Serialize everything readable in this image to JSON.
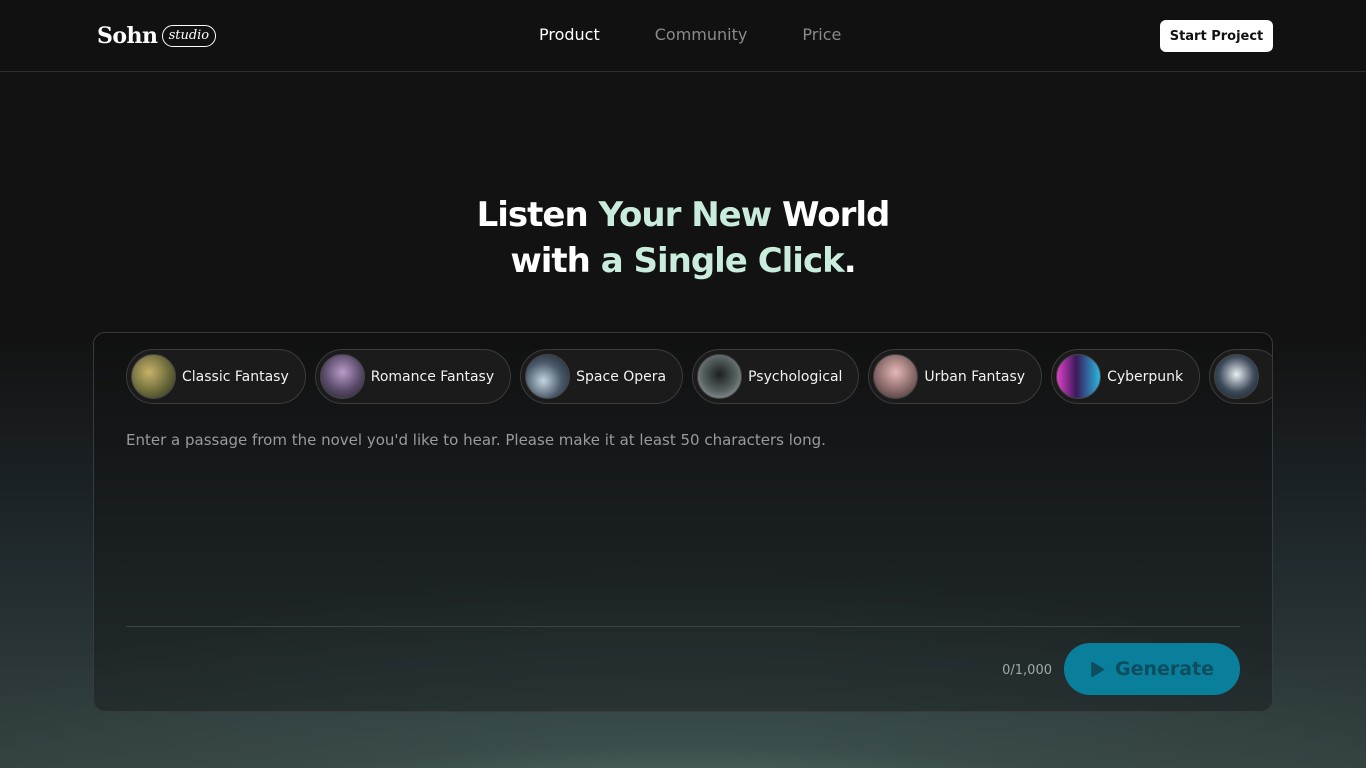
{
  "header": {
    "logo_word": "Sohn",
    "logo_badge": "studio",
    "nav": [
      {
        "label": "Product"
      },
      {
        "label": "Community"
      },
      {
        "label": "Price"
      }
    ],
    "cta_label": "Start Project"
  },
  "hero": {
    "line1_a": "Listen ",
    "line1_b": "Your New",
    "line1_c": " World",
    "line2_a": "with ",
    "line2_b": "a Single Click",
    "line2_c": "."
  },
  "genres": [
    {
      "label": "Classic Fantasy",
      "thumb": "#6b6a3a"
    },
    {
      "label": "Romance Fantasy",
      "thumb": "#5a4a6a"
    },
    {
      "label": "Space Opera",
      "thumb": "#4a5a6a"
    },
    {
      "label": "Psychological",
      "thumb": "#5a6464"
    },
    {
      "label": "Urban Fantasy",
      "thumb": "#8a6a6a"
    },
    {
      "label": "Cyberpunk",
      "thumb": "#6a3a7a"
    },
    {
      "label": "",
      "thumb": "#3c4a5a"
    }
  ],
  "editor": {
    "placeholder": "Enter a passage from the novel you'd like to hear. Please make it at least 50 characters long.",
    "counter": "0/1,000",
    "generate_label": "Generate"
  },
  "colors": {
    "accent": "#c9ecdc",
    "button": "#0a7f9c"
  }
}
